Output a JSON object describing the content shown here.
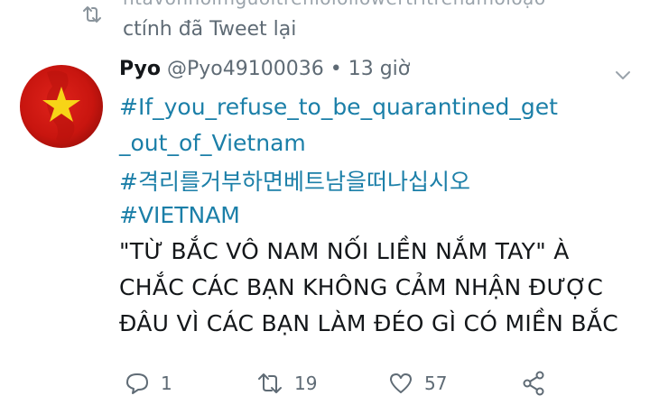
{
  "retweet_context": {
    "cut_text": "ntavonnoimguoitrenioioiiowertritrenamoioạo",
    "label": "ctính đã Tweet lại"
  },
  "tweet": {
    "author_name": "Pyo",
    "handle": "@Pyo49100036",
    "separator": "•",
    "time": "13 giờ",
    "lines": [
      "#If_you_refuse_to_be_quarantined_get",
      "_out_of_Vietnam",
      "#격리를거부하면베트남을떠나십시오",
      "#VIETNAM",
      "\"TỪ BẮC VÔ NAM NỐI LIỀN NẮM TAY\" À",
      "CHẮC CÁC BẠN KHÔNG CẢM NHẬN ĐƯỢC",
      "ĐÂU VÌ CÁC BẠN LÀM ĐÉO GÌ CÓ MIỀN BẮC"
    ]
  },
  "actions": {
    "reply_count": "1",
    "retweet_count": "19",
    "like_count": "57"
  },
  "icons": {
    "retweet": "retweet-icon",
    "reply": "reply-icon",
    "like": "heart-icon",
    "share": "share-icon",
    "caret": "chevron-down-icon"
  },
  "colors": {
    "hashtag": "#1b7fa8",
    "secondary_text": "#5f6b75",
    "primary_text": "#14171a",
    "avatar_red": "#d11a12",
    "avatar_star": "#f7d417"
  }
}
